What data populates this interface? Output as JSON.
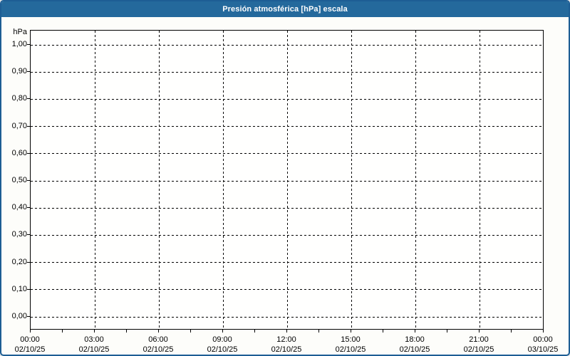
{
  "window": {
    "title": "Presión atmosférica [hPa] escala"
  },
  "colors": {
    "titlebar": "#24699c",
    "frame_border": "#1d5e94",
    "title_text": "#ffffff",
    "plot_border": "#000000",
    "grid": "#000000",
    "label_text": "#000000",
    "background": "#fdfdfa"
  },
  "chart_data": {
    "type": "line",
    "title": "Presión atmosférica [hPa] escala",
    "ylabel": "hPa",
    "ylim": [
      0.0,
      1.0
    ],
    "y_tick_step": 0.1,
    "y_ticks": [
      "1,00",
      "0,90",
      "0,80",
      "0,70",
      "0,60",
      "0,50",
      "0,40",
      "0,30",
      "0,20",
      "0,10",
      "0,00"
    ],
    "x_ticks": [
      {
        "time": "00:00",
        "date": "02/10/25"
      },
      {
        "time": "03:00",
        "date": "02/10/25"
      },
      {
        "time": "06:00",
        "date": "02/10/25"
      },
      {
        "time": "09:00",
        "date": "02/10/25"
      },
      {
        "time": "12:00",
        "date": "02/10/25"
      },
      {
        "time": "15:00",
        "date": "02/10/25"
      },
      {
        "time": "18:00",
        "date": "02/10/25"
      },
      {
        "time": "21:00",
        "date": "02/10/25"
      },
      {
        "time": "00:00",
        "date": "03/10/25"
      }
    ],
    "series": [],
    "grid": "dashed",
    "legend_position": "none"
  }
}
